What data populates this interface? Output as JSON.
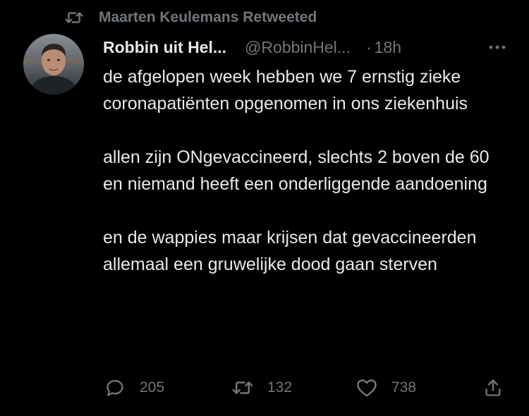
{
  "retweet_banner": {
    "icon": "retweet-icon",
    "text": "Maarten Keulemans Retweeted"
  },
  "tweet": {
    "author": {
      "display_name": "Robbin uit Hel...",
      "handle": "@RobbinHel...",
      "separator": "·",
      "time": "18h"
    },
    "paragraphs": [
      "de afgelopen week hebben we 7 ernstig zieke coronapatiënten opgenomen in ons ziekenhuis",
      "allen zijn ONgevaccineerd, slechts 2 boven de 60 en niemand heeft een onderliggende aandoening",
      "en de wappies maar krijsen dat gevaccineerden allemaal een gruwelijke dood gaan sterven"
    ],
    "actions": {
      "reply_count": "205",
      "retweet_count": "132",
      "like_count": "738"
    }
  },
  "colors": {
    "background": "#000000",
    "primary_text": "#e7e9ea",
    "secondary_text": "#71767b"
  }
}
